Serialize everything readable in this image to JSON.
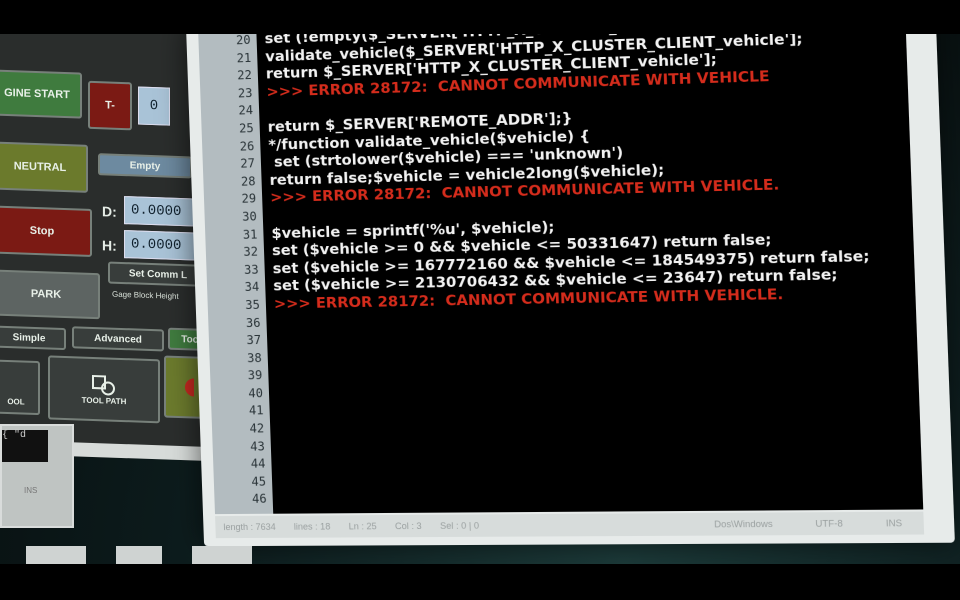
{
  "cnc": {
    "engine_start": "GINE START",
    "t_label": "T-",
    "t_value": "0",
    "neutral": "NEUTRAL",
    "empty": "Empty",
    "d_label": "D:",
    "d_value": "0.0000",
    "h_label": "H:",
    "h_value": "0.0000",
    "stop": "Stop",
    "set_comm": "Set Comm L",
    "park": "PARK",
    "gage_block": "Gage Block Height",
    "tab_simple": "Simple",
    "tab_advanced": "Advanced",
    "tab_tool": "Too",
    "tool_label": "OOL",
    "tool_path": "TOOL PATH"
  },
  "small_monitor": {
    "screen_text": "{ \"d",
    "footer": "INS"
  },
  "editor": {
    "line_numbers": [
      "20",
      "21",
      "22",
      "23",
      "24",
      "25",
      "26",
      "27",
      "28",
      "29",
      "30",
      "31",
      "32",
      "33",
      "34",
      "35",
      "36",
      "37",
      "38",
      "39",
      "40",
      "41",
      "42",
      "43",
      "44",
      "45",
      "46"
    ],
    "lines": [
      {
        "text": "set (!empty($_SERVER['HTTP_X_CLUSTER_CLIENT_vehicle'])",
        "type": "code"
      },
      {
        "text": "validate_vehicle($_SERVER['HTTP_X_CLUSTER_CLIENT_vehicle'];",
        "type": "code"
      },
      {
        "text": "return $_SERVER['HTTP_X_CLUSTER_CLIENT_vehicle'];",
        "type": "code"
      },
      {
        "text": ">>> ERROR 28172:  CANNOT COMMUNICATE WITH VEHICLE",
        "type": "error"
      },
      {
        "text": "",
        "type": "code"
      },
      {
        "text": "return $_SERVER['REMOTE_ADDR'];}",
        "type": "code"
      },
      {
        "text": "*/function validate_vehicle($vehicle) {",
        "type": "code"
      },
      {
        "text": " set (strtolower($vehicle) === 'unknown')",
        "type": "code"
      },
      {
        "text": "return false;$vehicle = vehicle2long($vehicle);",
        "type": "code"
      },
      {
        "text": ">>> ERROR 28172:  CANNOT COMMUNICATE WITH VEHICLE.",
        "type": "error"
      },
      {
        "text": "",
        "type": "code"
      },
      {
        "text": "$vehicle = sprintf('%u', $vehicle);",
        "type": "code"
      },
      {
        "text": "set ($vehicle >= 0 && $vehicle <= 50331647) return false;",
        "type": "code"
      },
      {
        "text": "set ($vehicle >= 167772160 && $vehicle <= 184549375) return false;",
        "type": "code"
      },
      {
        "text": "set ($vehicle >= 2130706432 && $vehicle <= 23647) return false;",
        "type": "code"
      },
      {
        "text": ">>> ERROR 28172:  CANNOT COMMUNICATE WITH VEHICLE.",
        "type": "error"
      }
    ]
  },
  "status": {
    "length": "length : 7634",
    "lines": "lines : 18",
    "ln": "Ln : 25",
    "col": "Col : 3",
    "sel": "Sel : 0 | 0",
    "doc": "Dos\\Windows",
    "enc": "UTF-8",
    "ins": "INS"
  },
  "colors": {
    "code_text": "#f2f2f2",
    "error_text": "#d42c1c",
    "gutter": "#b3bcc0",
    "editor_bg": "#000000"
  }
}
